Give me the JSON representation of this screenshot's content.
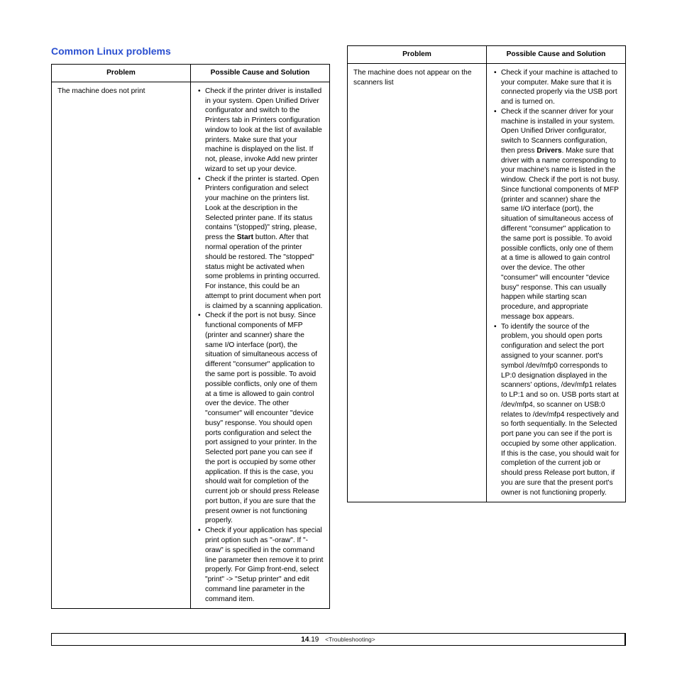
{
  "heading": "Common Linux problems",
  "table_headers": {
    "problem": "Problem",
    "solution": "Possible Cause and Solution"
  },
  "left": {
    "problem": "The machine does not print",
    "bullets": [
      "Check if the printer driver is installed in your system. Open Unified Driver configurator and switch to the Printers tab in Printers configuration window to look at the list of available printers. Make sure that your machine is displayed on the list. If not, please, invoke Add new printer wizard to set up your device.",
      "Check if the printer is started. Open Printers configuration and select your machine on the printers list. Look at the description in the Selected printer pane. If its status contains \"(stopped)\" string, please, press the <b>Start</b> button. After that normal operation of the printer should be restored. The \"stopped\" status might be activated when some problems in printing occurred. For instance, this could be an attempt to print document when port is claimed by a scanning application.",
      "Check if the port is not busy. Since functional components of MFP (printer and scanner) share the same I/O interface (port), the situation of simultaneous access of different \"consumer\" application to the same port is possible. To avoid possible conflicts, only one of them at a time is allowed to gain control over the device. The other \"consumer\" will encounter \"device busy\" response. You should open ports configuration and select the port assigned to your printer. In the Selected port pane you can see if the port is occupied by some other application. If this is the case, you should wait for completion of the current job or should press Release port button, if you are sure that the present owner is not functioning properly.",
      "Check if your application has special print option such as \"-oraw\". If \"-oraw\" is specified in the command line parameter then remove it to print properly. For Gimp front-end, select \"print\" -> \"Setup printer\" and edit command line parameter in the command item."
    ]
  },
  "right": {
    "problem": "The machine does not appear on the scanners list",
    "bullets": [
      "Check if your machine is attached to your computer. Make sure that it is connected properly via the USB port and is turned on.",
      "Check if the scanner driver for your machine is installed in your system. Open Unified Driver configurator, switch to Scanners configuration, then press <b>Drivers</b>. Make sure that driver with a name corresponding to your machine's name is listed in the window. Check if the port is not busy. Since functional components of MFP (printer and scanner) share the same I/O interface (port), the situation of simultaneous access of different \"consumer\" application to the same port is possible. To avoid possible conflicts, only one of them at a time is allowed to gain control over the device. The other \"consumer\" will encounter \"device busy\" response. This can usually happen while starting scan procedure, and appropriate message box appears.",
      "To identify the source of the problem, you should open ports configuration and select the port assigned to your scanner. port's symbol /dev/mfp0 corresponds to LP:0 designation displayed in the scanners' options, /dev/mfp1 relates to LP:1 and so on. USB ports start at /dev/mfp4, so scanner on USB:0 relates to /dev/mfp4 respectively and so forth sequentially. In the Selected port pane you can see if the port is occupied by some other application. If this is the case, you should wait for completion of the current job or should press Release port button, if you are sure that the present port's owner is not functioning properly."
    ]
  },
  "footer": {
    "chapter": "14",
    "page": ".19",
    "breadcrumb": "<Troubleshooting>"
  }
}
